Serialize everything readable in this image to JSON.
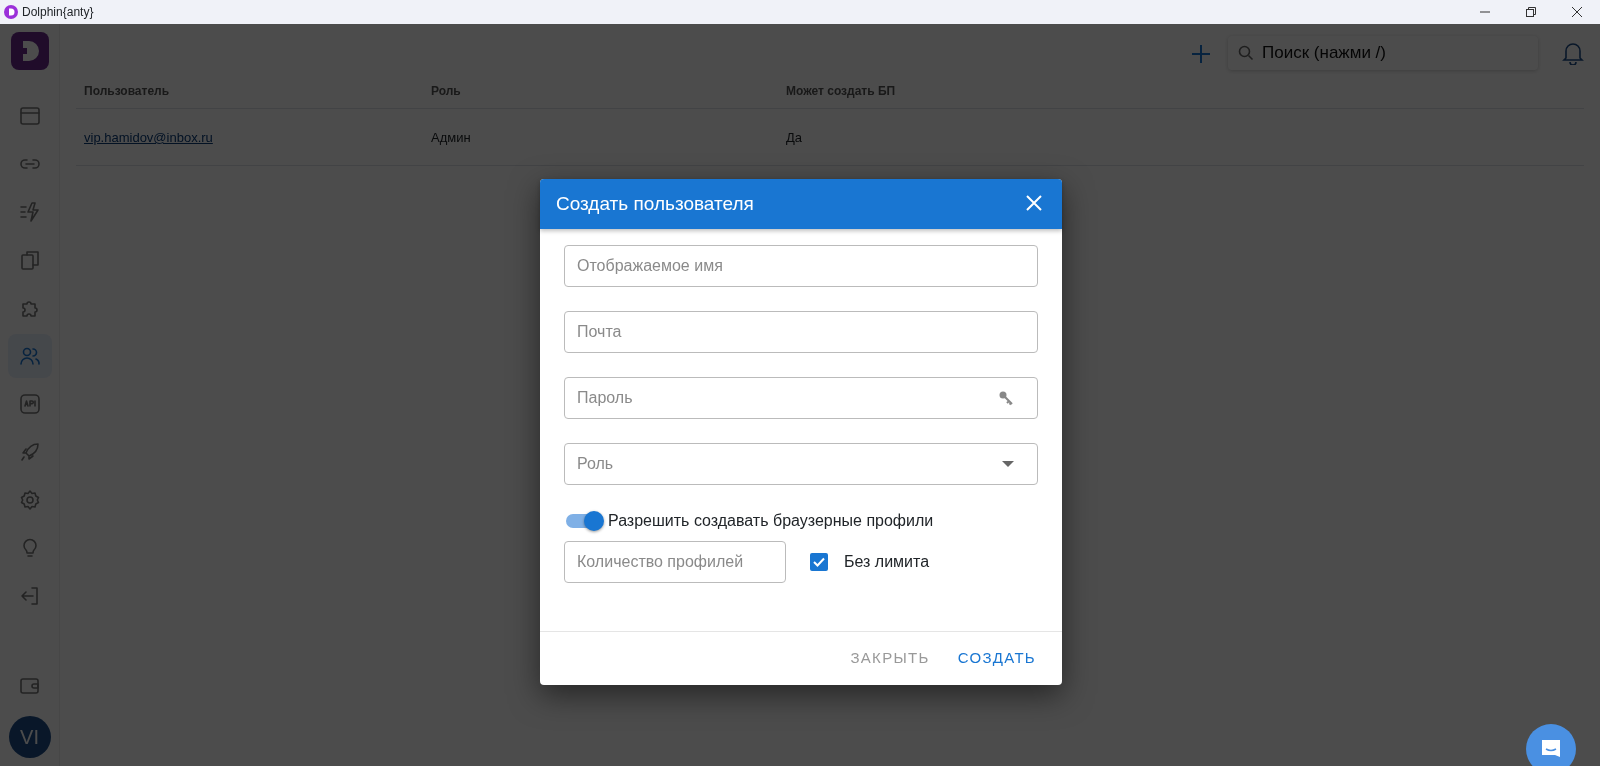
{
  "window": {
    "title": "Dolphin{anty}"
  },
  "sidebar": {
    "items": [
      {
        "selected": false
      },
      {
        "selected": false
      },
      {
        "selected": false
      },
      {
        "selected": false
      },
      {
        "selected": false
      },
      {
        "selected": true
      },
      {
        "selected": false
      },
      {
        "selected": false
      },
      {
        "selected": false
      },
      {
        "selected": false
      },
      {
        "selected": false
      }
    ],
    "avatar": "VI"
  },
  "header": {
    "search": {
      "placeholder": "Поиск (нажми /)"
    }
  },
  "table": {
    "columns": [
      "Пользователь",
      "Роль",
      "Может создать БП"
    ],
    "rows": [
      {
        "cells": [
          "vip.hamidov@inbox.ru",
          "Админ",
          "Да"
        ]
      }
    ]
  },
  "dialog": {
    "title": "Создать пользователя",
    "fields": [
      {
        "kind": "text",
        "placeholder": "Отображаемое имя"
      },
      {
        "kind": "text",
        "placeholder": "Почта"
      },
      {
        "kind": "password",
        "placeholder": "Пароль"
      },
      {
        "kind": "select",
        "placeholder": "Роль"
      }
    ],
    "toggle": {
      "label": "Разрешить создавать браузерные профили",
      "on": true
    },
    "count": {
      "placeholder": "Количество профилей"
    },
    "unlimited": {
      "label": "Без лимита",
      "checked": true
    },
    "buttons": [
      {
        "label": "ЗАКРЫТЬ",
        "kind": "secondary"
      },
      {
        "label": "СОЗДАТЬ",
        "kind": "primary"
      }
    ]
  }
}
